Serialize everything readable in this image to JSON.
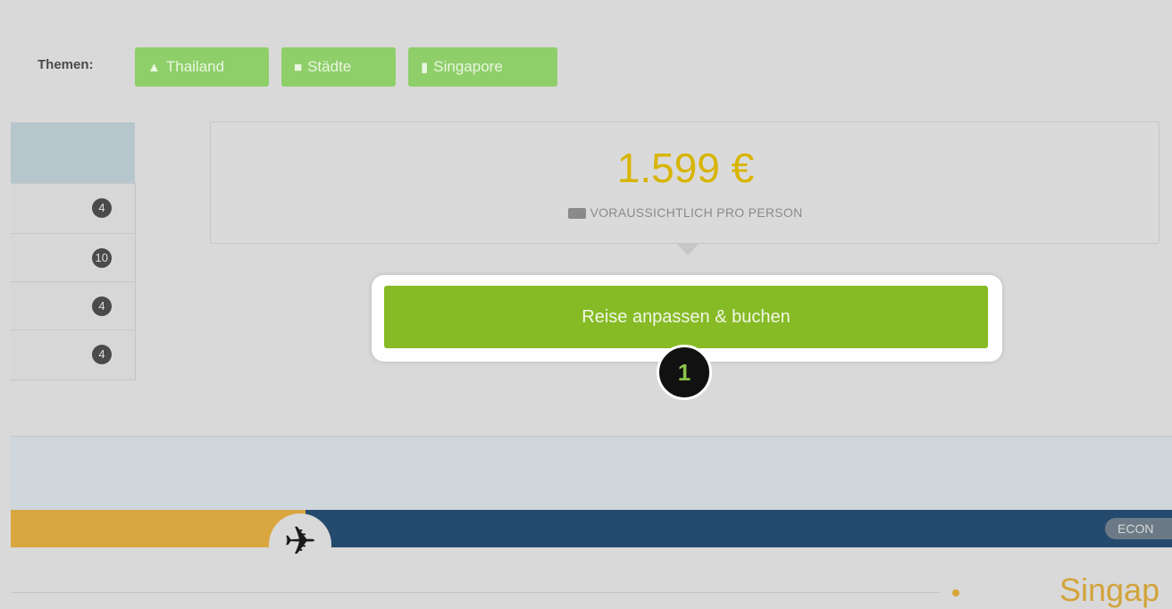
{
  "themes": {
    "label": "Themen:",
    "tags": [
      {
        "label": "Thailand",
        "icon": "temple-icon"
      },
      {
        "label": "Städte",
        "icon": "suitcase-icon"
      },
      {
        "label": "Singapore",
        "icon": "skyline-icon"
      }
    ]
  },
  "left_list": {
    "badges": [
      "4",
      "10",
      "4",
      "4"
    ]
  },
  "price": {
    "amount": "1.599 €",
    "note": "VORAUSSICHTLICH PRO PERSON",
    "note_icon": "card-icon"
  },
  "cta": {
    "label": "Reise anpassen & buchen"
  },
  "step_marker": "1",
  "flight": {
    "icon": "plane-icon",
    "class_badge": "ECON",
    "destination": "Singap"
  },
  "colors": {
    "accent_green": "#86bb25",
    "price_yellow": "#d8b400",
    "bar_orange": "#daa640",
    "bar_blue": "#244a6e"
  }
}
